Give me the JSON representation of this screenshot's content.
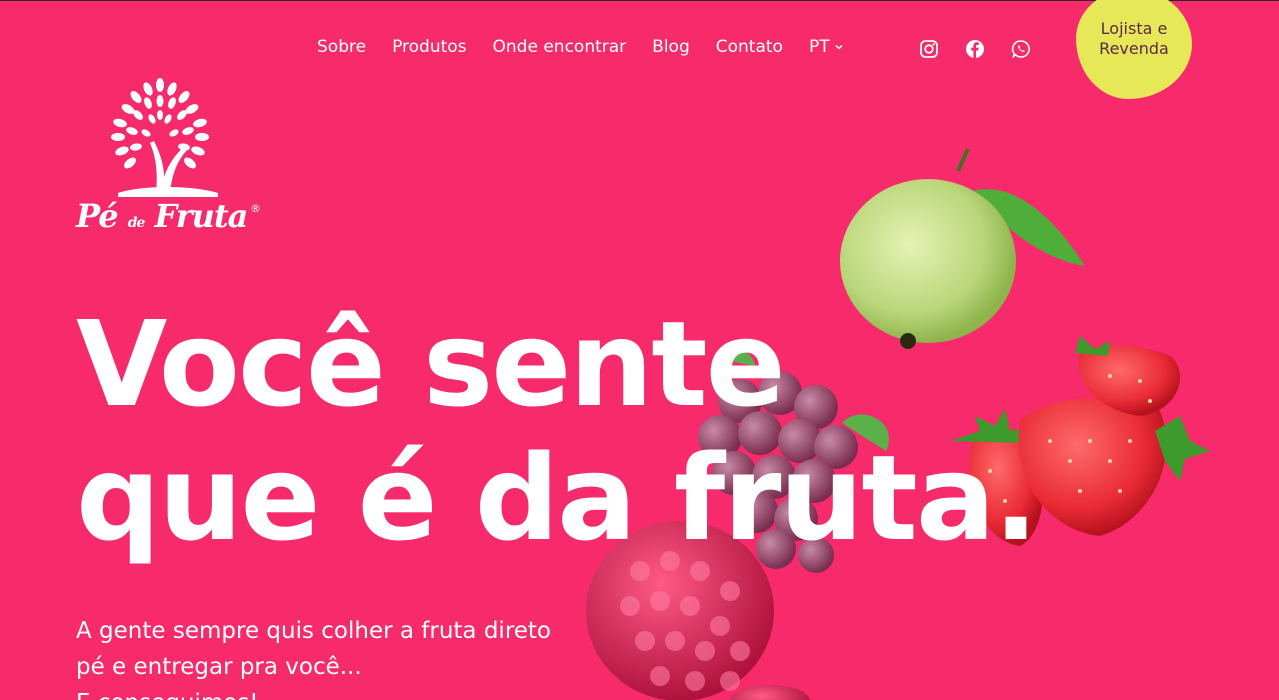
{
  "nav": {
    "items": [
      {
        "label": "Sobre"
      },
      {
        "label": "Produtos"
      },
      {
        "label": "Onde encontrar"
      },
      {
        "label": "Blog"
      },
      {
        "label": "Contato"
      },
      {
        "label": "PT"
      }
    ]
  },
  "social": {
    "icons": [
      "instagram-icon",
      "facebook-icon",
      "whatsapp-icon"
    ]
  },
  "cta": {
    "line1": "Lojista e",
    "line2": "Revenda"
  },
  "logo": {
    "name_part1": "Pé",
    "name_part2": "de",
    "name_part3": "Fruta",
    "registered": "®"
  },
  "hero": {
    "line1": "Você sente",
    "line2": "que é da fruta.",
    "sub1": "A gente sempre quis colher a fruta direto",
    "sub2": "pé e entregar pra você...",
    "sub3": "E conseguimos!"
  },
  "colors": {
    "background": "#f72a6c",
    "cta_bg": "#e6e857",
    "cta_text": "#5a2a4a"
  }
}
